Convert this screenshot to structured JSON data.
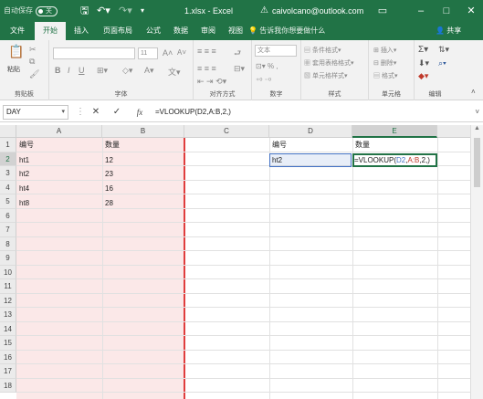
{
  "titlebar": {
    "autosave_label": "自动保存",
    "autosave_state": "关",
    "file_name": "1.xlsx - Excel",
    "account": "caivolcano@outlook.com"
  },
  "tabs": [
    {
      "label": "文件",
      "active": false
    },
    {
      "label": "开始",
      "active": true
    },
    {
      "label": "插入",
      "active": false
    },
    {
      "label": "页面布局",
      "active": false
    },
    {
      "label": "公式",
      "active": false
    },
    {
      "label": "数据",
      "active": false
    },
    {
      "label": "审阅",
      "active": false
    },
    {
      "label": "视图",
      "active": false
    }
  ],
  "tellme": "告诉我你想要做什么",
  "share_label": "共享",
  "ribbon": {
    "groups": [
      {
        "label": "剪贴板"
      },
      {
        "label": "字体"
      },
      {
        "label": "对齐方式"
      },
      {
        "label": "数字"
      },
      {
        "label": "样式"
      },
      {
        "label": "单元格"
      },
      {
        "label": "编辑"
      }
    ],
    "paste_label": "粘贴",
    "font_size": "11",
    "number_format": "文本",
    "styles": {
      "conditional": "条件格式",
      "table": "套用表格格式",
      "cell_styles": "单元格样式"
    },
    "cells": {
      "insert": "插入",
      "delete": "删除",
      "format": "格式"
    }
  },
  "formula_bar": {
    "name_box": "DAY",
    "cancel": "✕",
    "enter": "✓",
    "fx": "fx",
    "formula": "=VLOOKUP(D2,A:B,2,)"
  },
  "grid": {
    "columns": [
      "A",
      "B",
      "C",
      "D",
      "E"
    ],
    "rows": [
      "1",
      "2",
      "3",
      "4",
      "5",
      "6",
      "7",
      "8",
      "9",
      "10",
      "11",
      "12",
      "13",
      "14",
      "15",
      "16",
      "17",
      "18"
    ],
    "selected_column": "E",
    "selected_row": "2",
    "cells": {
      "A1": "编号",
      "B1": "数量",
      "A2": "ht1",
      "B2": "12",
      "A3": "ht2",
      "B3": "23",
      "A4": "ht4",
      "B4": "16",
      "A5": "ht8",
      "B5": "28",
      "D1": "编号",
      "E1": "数量",
      "D2": "ht2"
    },
    "edit_cell": {
      "prefix": "=VLOOKUP(",
      "ref1": "D2",
      "sep1": ",",
      "ref2": "A:B",
      "suffix": ",2,)"
    }
  },
  "colors": {
    "accent": "#217346",
    "copy_range": "#fbe8e8",
    "ref_blue": "#4472c4",
    "ref_red": "#c0392b"
  }
}
